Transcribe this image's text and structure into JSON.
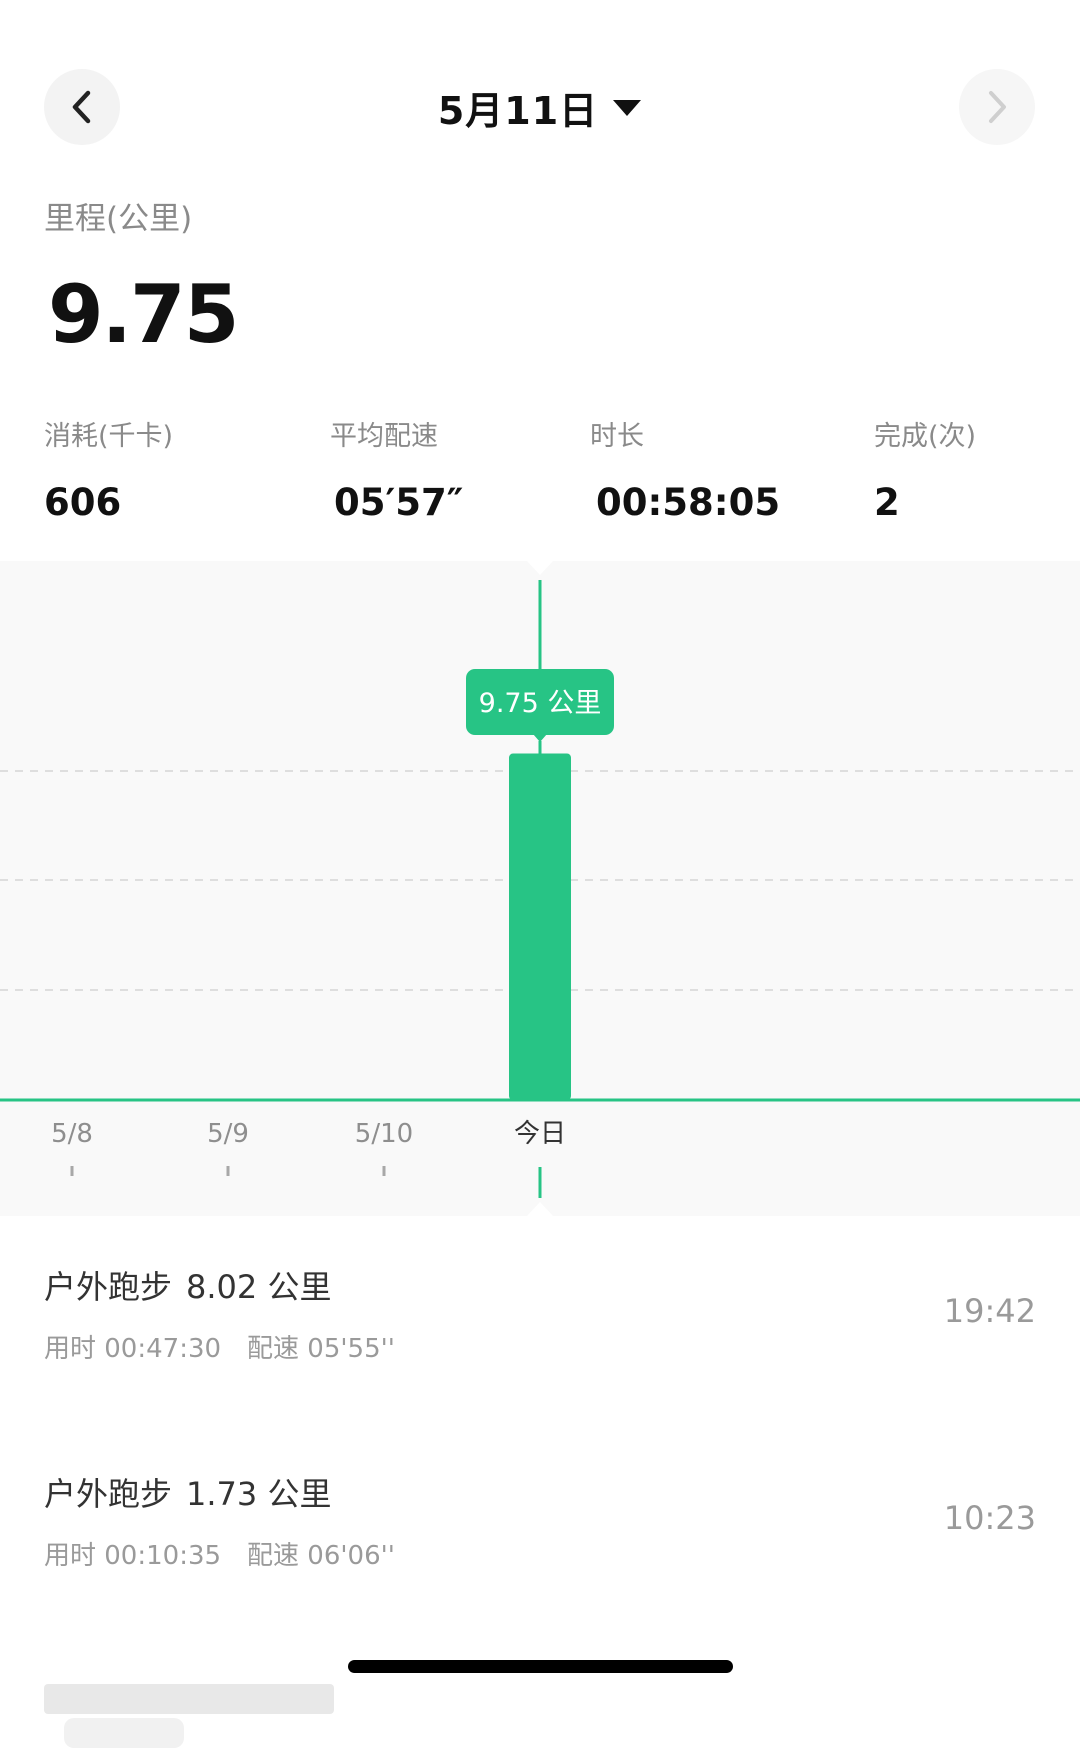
{
  "header": {
    "date_label": "5月11日",
    "prev_icon": "chevron-left-icon",
    "next_icon": "chevron-right-icon",
    "caret_icon": "caret-down-icon"
  },
  "summary": {
    "distance_label": "里程(公里)",
    "distance_value": "9.75"
  },
  "stats": {
    "calories": {
      "label": "消耗(千卡)",
      "value": "606"
    },
    "pace": {
      "label": "平均配速",
      "value": "05′57″"
    },
    "duration": {
      "label": "时长",
      "value": "00:58:05"
    },
    "count": {
      "label": "完成(次)",
      "value": "2"
    }
  },
  "chart_data": {
    "type": "bar",
    "categories": [
      "5/8",
      "5/9",
      "5/10",
      "今日"
    ],
    "values": [
      0,
      0,
      0,
      9.75
    ],
    "selected_index": 3,
    "tooltip": "9.75 公里",
    "ylim": [
      0,
      15
    ],
    "grid": true,
    "bar_color": "#27c485"
  },
  "workouts": [
    {
      "type": "户外跑步",
      "distance": "8.02 公里",
      "duration": "用时 00:47:30",
      "pace": "配速 05'55''",
      "time": "19:42"
    },
    {
      "type": "户外跑步",
      "distance": "1.73 公里",
      "duration": "用时 00:10:35",
      "pace": "配速 06'06''",
      "time": "10:23"
    }
  ],
  "colors": {
    "accent": "#27c485",
    "chart_bg": "#f9f9f9",
    "muted_text": "#8a8a8a"
  }
}
